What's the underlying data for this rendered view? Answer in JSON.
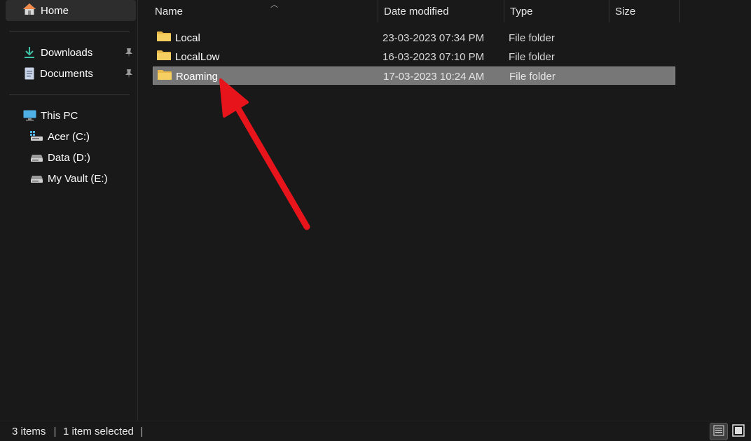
{
  "sidebar": {
    "home": {
      "label": "Home",
      "icon": "home-icon"
    },
    "quick_access": [
      {
        "label": "Downloads",
        "icon": "download-icon",
        "pinned": true
      },
      {
        "label": "Documents",
        "icon": "document-icon",
        "pinned": true
      }
    ],
    "this_pc": {
      "label": "This PC",
      "icon": "computer-icon"
    },
    "drives": [
      {
        "label": "Acer (C:)",
        "icon": "system-drive-icon"
      },
      {
        "label": "Data (D:)",
        "icon": "drive-icon"
      },
      {
        "label": "My Vault (E:)",
        "icon": "drive-icon"
      }
    ]
  },
  "columns": {
    "name": "Name",
    "date_modified": "Date modified",
    "type": "Type",
    "size": "Size"
  },
  "files": [
    {
      "name": "Local",
      "date": "23-03-2023 07:34 PM",
      "type": "File folder",
      "selected": false
    },
    {
      "name": "LocalLow",
      "date": "16-03-2023 07:10 PM",
      "type": "File folder",
      "selected": false
    },
    {
      "name": "Roaming",
      "date": "17-03-2023 10:24 AM",
      "type": "File folder",
      "selected": true
    }
  ],
  "status": {
    "item_count": "3 items",
    "selection": "1 item selected"
  },
  "colors": {
    "background": "#191919",
    "selected_row": "#777777",
    "folder": "#f2c94c",
    "annotation_arrow": "#e8141b"
  }
}
